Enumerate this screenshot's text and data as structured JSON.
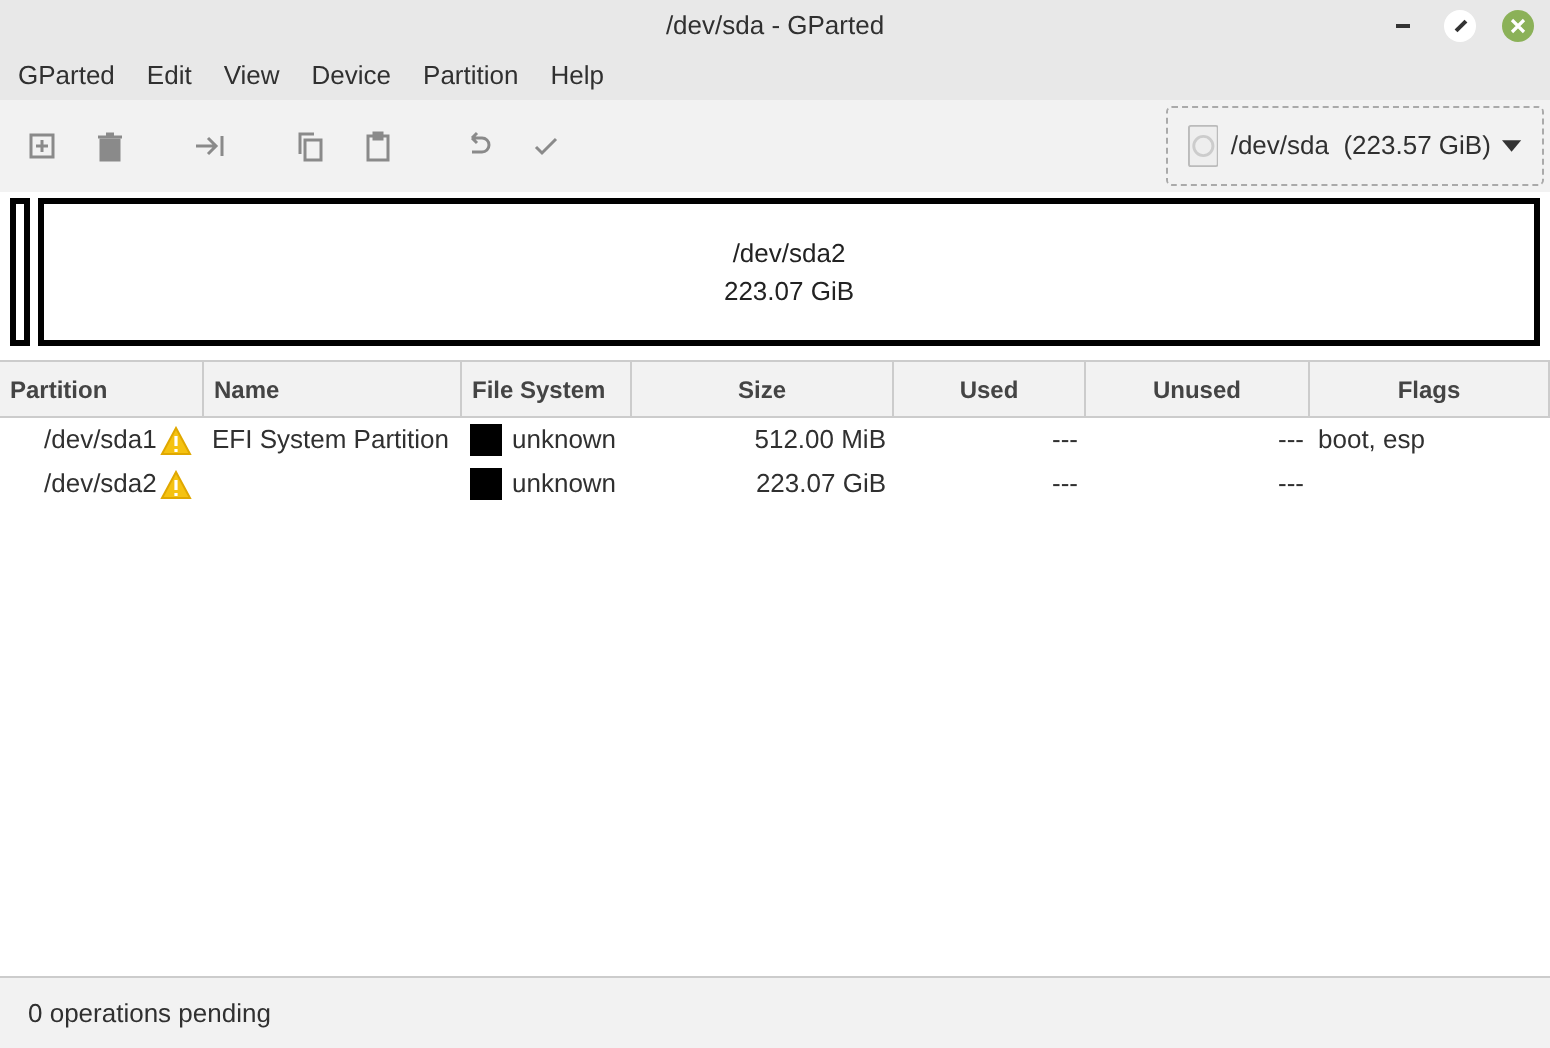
{
  "window": {
    "title": "/dev/sda - GParted"
  },
  "menu": [
    "GParted",
    "Edit",
    "View",
    "Device",
    "Partition",
    "Help"
  ],
  "toolbar": [
    {
      "kind": "new",
      "disabled": true
    },
    {
      "kind": "delete",
      "disabled": true
    },
    {
      "kind": "resize",
      "disabled": true
    },
    {
      "kind": "copy",
      "disabled": true
    },
    {
      "kind": "paste",
      "disabled": true
    },
    {
      "kind": "undo",
      "disabled": true
    },
    {
      "kind": "apply",
      "disabled": true
    }
  ],
  "device": {
    "label": "/dev/sda  (223.57 GiB)"
  },
  "disk_map": [
    {
      "kind": "sliver",
      "selected": false
    },
    {
      "kind": "block",
      "name": "/dev/sda2",
      "size": "223.07 GiB",
      "selected": false
    }
  ],
  "table": {
    "columns": [
      "Partition",
      "Name",
      "File System",
      "Size",
      "Used",
      "Unused",
      "Flags"
    ],
    "rows": [
      {
        "partition": "/dev/sda1",
        "warning": true,
        "name": "EFI System Partition",
        "fs": "unknown",
        "color": "#000000",
        "size": "512.00 MiB",
        "used": "---",
        "unused": "---",
        "flags": "boot, esp"
      },
      {
        "partition": "/dev/sda2",
        "warning": true,
        "fs": "unknown",
        "color": "#000000",
        "size": "223.07 GiB",
        "used": "---",
        "unused": "---"
      }
    ]
  },
  "status_bar": "0 operations pending"
}
